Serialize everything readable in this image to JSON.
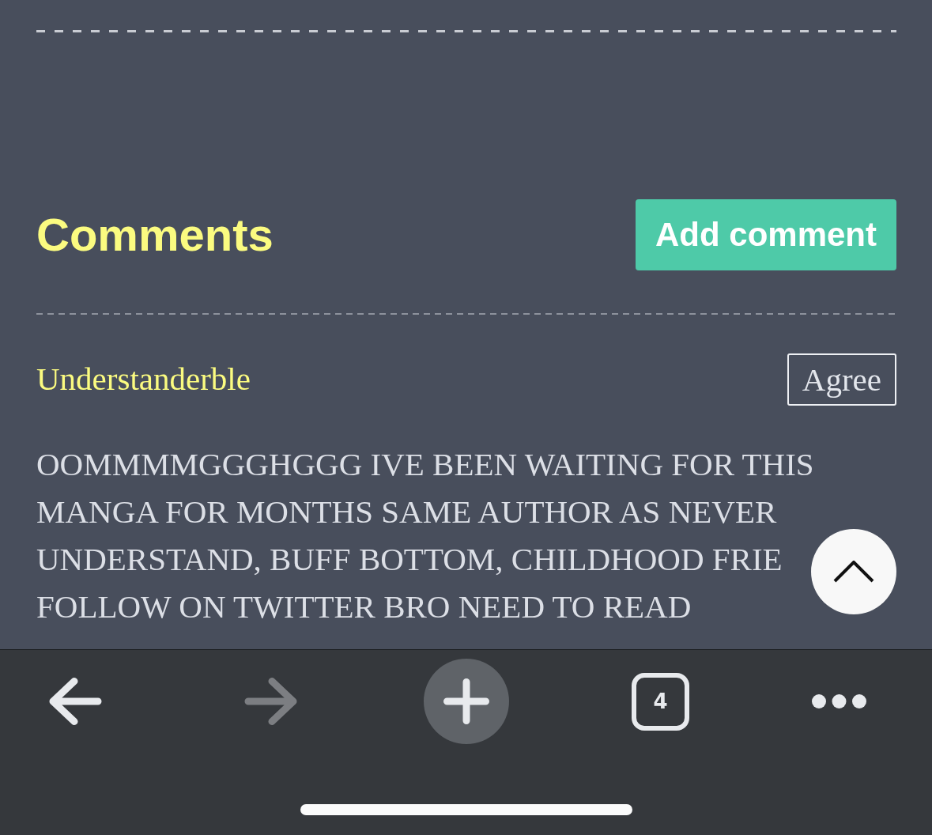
{
  "comments_header": {
    "title": "Comments",
    "add_button": "Add comment"
  },
  "comments": [
    {
      "author": "Understanderble",
      "agree_button": "Agree",
      "body_lines": [
        "OOMMMMGGGHGGG IVE BEEN WAITING FOR THIS",
        "MANGA FOR MONTHS SAME AUTHOR AS NEVER",
        "UNDERSTAND, BUFF BOTTOM, CHILDHOOD FRIE",
        "FOLLOW ON TWITTER BRO NEED TO READ"
      ]
    }
  ],
  "toolbar": {
    "buttons": [
      {
        "kind": "back",
        "disabled": false
      },
      {
        "kind": "forward",
        "disabled": true
      },
      {
        "kind": "new-tab",
        "disabled": false
      },
      {
        "kind": "tabs",
        "disabled": false,
        "count": "4"
      },
      {
        "kind": "more",
        "disabled": false
      }
    ]
  }
}
